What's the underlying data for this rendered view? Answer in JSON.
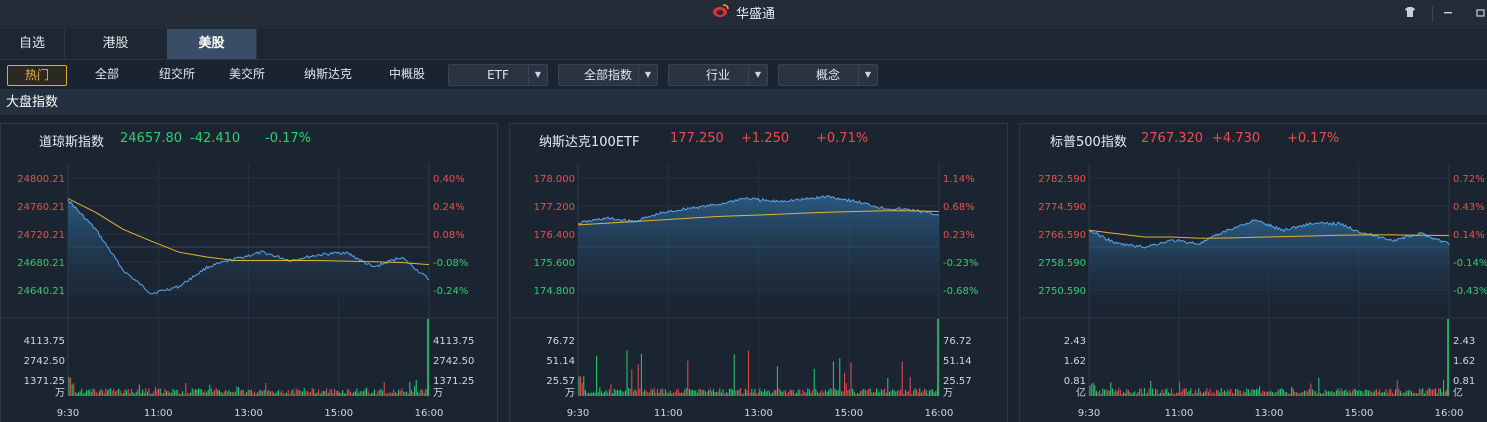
{
  "app": {
    "title": "华盛通"
  },
  "tabs": [
    {
      "label": "自选",
      "active": false
    },
    {
      "label": "港股",
      "active": false
    },
    {
      "label": "美股",
      "active": true
    }
  ],
  "filters": {
    "buttons": [
      "热门",
      "全部",
      "纽交所",
      "美交所",
      "纳斯达克",
      "中概股"
    ],
    "dropdowns": [
      "ETF",
      "全部指数",
      "行业",
      "概念"
    ]
  },
  "section": {
    "title": "大盘指数"
  },
  "colors": {
    "up": "#f14c4c",
    "down": "#28d071",
    "price_line": "#5aa4e8",
    "avg_line": "#e3b232",
    "accent": "#e6a63a"
  },
  "panels": [
    {
      "name": "道琼斯指数",
      "price": "24657.80",
      "change": "-42.410",
      "pct": "-0.17%",
      "direction": "down",
      "price_ticks": [
        "24800.21",
        "24760.21",
        "24720.21",
        "24680.21",
        "24640.21"
      ],
      "pct_ticks": [
        "0.40%",
        "0.24%",
        "0.08%",
        "-0.08%",
        "-0.24%"
      ],
      "vol_ticks": [
        "4113.75",
        "2742.50",
        "1371.25"
      ],
      "vol_unit": "万",
      "time_ticks": [
        "9:30",
        "11:00",
        "13:00",
        "15:00",
        "16:00"
      ]
    },
    {
      "name": "纳斯达克100ETF",
      "price": "177.250",
      "change": "+1.250",
      "pct": "+0.71%",
      "direction": "up",
      "price_ticks": [
        "178.000",
        "177.200",
        "176.400",
        "175.600",
        "174.800"
      ],
      "pct_ticks": [
        "1.14%",
        "0.68%",
        "0.23%",
        "-0.23%",
        "-0.68%"
      ],
      "vol_ticks": [
        "76.72",
        "51.14",
        "25.57"
      ],
      "vol_unit": "万",
      "time_ticks": [
        "9:30",
        "11:00",
        "13:00",
        "15:00",
        "16:00"
      ]
    },
    {
      "name": "标普500指数",
      "price": "2767.320",
      "change": "+4.730",
      "pct": "+0.17%",
      "direction": "up",
      "price_ticks": [
        "2782.590",
        "2774.590",
        "2766.590",
        "2758.590",
        "2750.590"
      ],
      "pct_ticks": [
        "0.72%",
        "0.43%",
        "0.14%",
        "-0.14%",
        "-0.43%"
      ],
      "vol_ticks": [
        "2.43",
        "1.62",
        "0.81"
      ],
      "vol_unit": "亿",
      "time_ticks": [
        "9:30",
        "11:00",
        "13:00",
        "15:00",
        "16:00"
      ]
    }
  ],
  "chart_data": [
    {
      "type": "line",
      "title": "道琼斯指数",
      "x": [
        "9:30",
        "10:00",
        "10:30",
        "11:00",
        "11:30",
        "12:00",
        "12:30",
        "13:00",
        "13:30",
        "14:00",
        "14:30",
        "15:00",
        "15:30",
        "16:00"
      ],
      "series": [
        {
          "values": [
            24788,
            24745,
            24685,
            24652,
            24662,
            24690,
            24702,
            24712,
            24700,
            24708,
            24712,
            24690,
            24705,
            24672
          ]
        },
        {
          "values": [
            24790,
            24770,
            24745,
            24728,
            24712,
            24705,
            24700,
            24700,
            24700,
            24700,
            24699,
            24698,
            24697,
            24694
          ]
        }
      ],
      "ylim": [
        24625,
        24820
      ]
    },
    {
      "type": "line",
      "title": "纳斯达克100ETF",
      "x": [
        "9:30",
        "10:00",
        "10:30",
        "11:00",
        "11:30",
        "12:00",
        "12:30",
        "13:00",
        "13:30",
        "14:00",
        "14:30",
        "15:00",
        "15:30",
        "16:00"
      ],
      "series": [
        {
          "values": [
            177.05,
            177.2,
            177.1,
            177.35,
            177.5,
            177.6,
            177.8,
            177.7,
            177.75,
            177.85,
            177.7,
            177.5,
            177.45,
            177.3
          ]
        },
        {
          "values": [
            177.0,
            177.05,
            177.1,
            177.15,
            177.2,
            177.25,
            177.28,
            177.31,
            177.35,
            177.38,
            177.4,
            177.42,
            177.42,
            177.4
          ]
        }
      ],
      "ylim": [
        174.4,
        178.4
      ]
    },
    {
      "type": "line",
      "title": "标普500指数",
      "x": [
        "9:30",
        "10:00",
        "10:30",
        "11:00",
        "11:30",
        "12:00",
        "12:30",
        "13:00",
        "13:30",
        "14:00",
        "14:30",
        "15:00",
        "15:30",
        "16:00"
      ],
      "series": [
        {
          "values": [
            2771,
            2767,
            2766,
            2768,
            2767,
            2771,
            2774,
            2771,
            2773,
            2773,
            2770,
            2768,
            2770,
            2767
          ]
        },
        {
          "values": [
            2771,
            2770,
            2769,
            2769,
            2768.6,
            2768.7,
            2768.9,
            2769.1,
            2769.3,
            2769.5,
            2769.6,
            2769.6,
            2769.5,
            2769.4
          ]
        }
      ],
      "ylim": [
        2746.6,
        2786.6
      ]
    }
  ]
}
